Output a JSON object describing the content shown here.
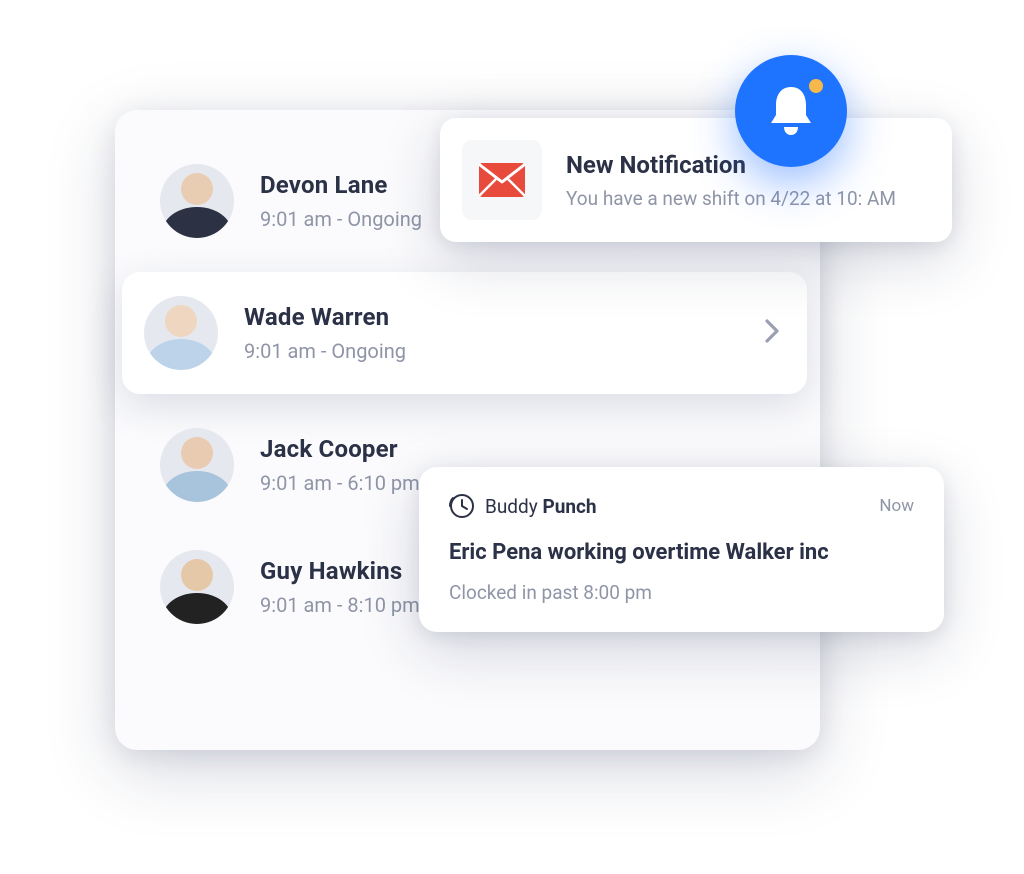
{
  "employees": [
    {
      "name": "Devon Lane",
      "time": "9:01 am - Ongoing",
      "avatarClass": "a1",
      "elevated": false,
      "chevron": false
    },
    {
      "name": "Wade Warren",
      "time": "9:01 am - Ongoing",
      "avatarClass": "a2",
      "elevated": true,
      "chevron": true
    },
    {
      "name": "Jack Cooper",
      "time": "9:01 am - 6:10 pm",
      "avatarClass": "a3",
      "elevated": false,
      "chevron": false
    },
    {
      "name": "Guy Hawkins",
      "time": "9:01 am - 8:10 pm",
      "avatarClass": "a4",
      "elevated": false,
      "chevron": false
    }
  ],
  "toast": {
    "title": "New Notification",
    "body": "You have a new shift on 4/22 at 10: AM"
  },
  "push": {
    "app_label_a": "Buddy ",
    "app_label_b": "Punch",
    "when": "Now",
    "title": "Eric Pena working  overtime Walker inc",
    "detail": "Clocked in past 8:00 pm"
  },
  "colors": {
    "accent": "#1e73ff",
    "badge_dot": "#f7b84b",
    "mail_icon": "#e84b3c"
  }
}
